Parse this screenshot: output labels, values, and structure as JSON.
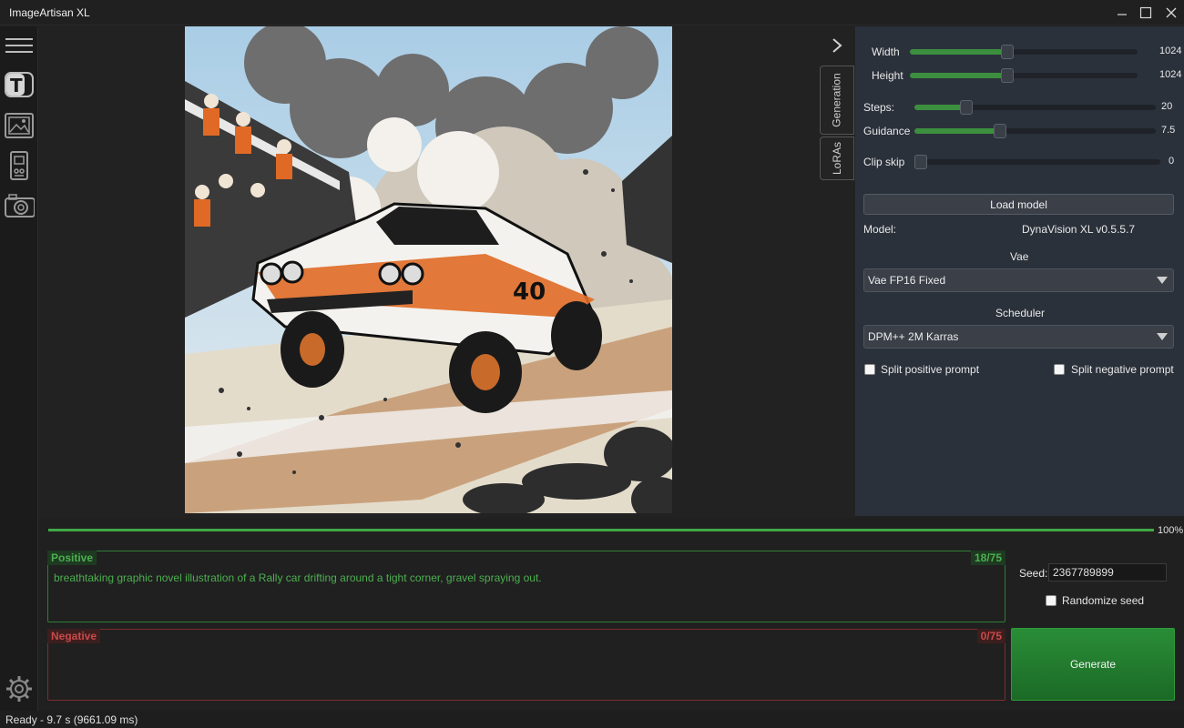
{
  "window": {
    "title": "ImageArtisan XL"
  },
  "sidebar": {
    "icons": [
      "menu-icon",
      "text-prompt-icon",
      "image-frame-icon",
      "device-icon",
      "camera-icon",
      "settings-icon"
    ]
  },
  "tabs": {
    "generation": "Generation",
    "loras": "LoRAs"
  },
  "panel": {
    "width_label": "Width",
    "width_value": "1024",
    "height_label": "Height",
    "height_value": "1024",
    "steps_label": "Steps:",
    "steps_value": "20",
    "guidance_label": "Guidance",
    "guidance_value": "7.5",
    "clipskip_label": "Clip skip",
    "clipskip_value": "0",
    "load_model": "Load model",
    "model_label": "Model:",
    "model_value": "DynaVision XL v0.5.5.7",
    "vae_label": "Vae",
    "vae_value": "Vae FP16 Fixed",
    "scheduler_label": "Scheduler",
    "scheduler_value": "DPM++ 2M Karras",
    "split_positive": "Split positive prompt",
    "split_negative": "Split negative prompt"
  },
  "progress": {
    "value": 1.0,
    "label": "100%"
  },
  "prompts": {
    "positive_label": "Positive",
    "positive_count": "18/75",
    "positive_text": "breathtaking graphic novel illustration of a Rally car drifting around a tight corner, gravel spraying out.",
    "negative_label": "Negative",
    "negative_count": "0/75",
    "negative_text": ""
  },
  "seed": {
    "label": "Seed:",
    "value": "2367789899",
    "randomize_label": "Randomize seed"
  },
  "generate_label": "Generate",
  "status": "Ready - 9.7 s (9661.09 ms)",
  "colors": {
    "accent": "#3fa844",
    "positive": "#4caf50",
    "negative": "#c94a4a",
    "panel_bg": "#2b313b"
  }
}
